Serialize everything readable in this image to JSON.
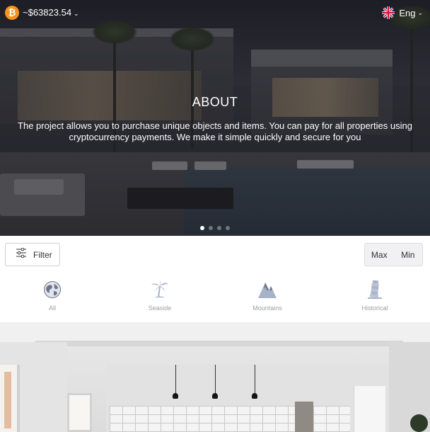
{
  "header": {
    "currency_icon": "bitcoin-icon",
    "currency_symbol": "₿",
    "price": "~$63823.54",
    "language": "Eng",
    "language_flag": "uk-flag-icon",
    "chevron": "⌄"
  },
  "hero": {
    "title": "ABOUT",
    "text": "The project allows you to purchase unique objects and items. You can pay for all properties using cryptocurrency payments. We make it simple quickly and secure for you",
    "slides_count": 4,
    "active_slide": 1
  },
  "toolbar": {
    "filter_label": "Filter",
    "sort_max_label": "Max",
    "sort_min_label": "Min"
  },
  "categories": [
    {
      "label": "All",
      "icon": "globe-icon"
    },
    {
      "label": "Seaside",
      "icon": "palm-tree-icon"
    },
    {
      "label": "Mountains",
      "icon": "mountain-icon"
    },
    {
      "label": "Historical",
      "icon": "leaning-tower-icon"
    }
  ],
  "colors": {
    "bitcoin": "#f7931a",
    "category_label": "#9a9ea8",
    "category_icon": "#a7b3c8",
    "sort_group_bg": "#f1f1f3"
  }
}
